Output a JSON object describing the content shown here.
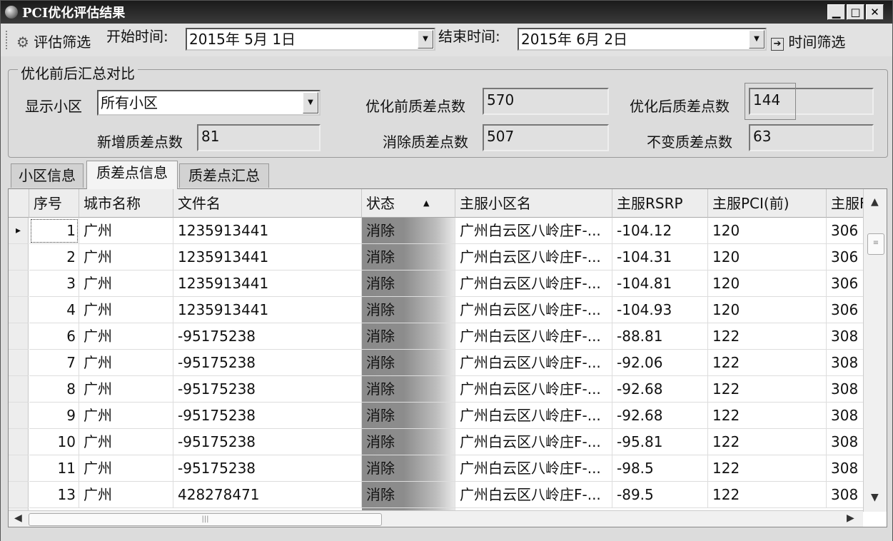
{
  "window": {
    "title": "PCI优化评估结果"
  },
  "toolbar": {
    "filter_label": "评估筛选",
    "start_label": "开始时间:",
    "start_value": "2015年 5月 1日",
    "end_label": "结束时间:",
    "end_value": "2015年 6月 2日",
    "time_filter_label": "时间筛选"
  },
  "summary": {
    "group_title": "优化前后汇总对比",
    "cell_label": "显示小区",
    "cell_value": "所有小区",
    "before_label": "优化前质差点数",
    "before_value": "570",
    "after_label": "优化后质差点数",
    "after_value": "144",
    "new_label": "新增质差点数",
    "new_value": "81",
    "removed_label": "消除质差点数",
    "removed_value": "507",
    "unchanged_label": "不变质差点数",
    "unchanged_value": "63"
  },
  "tabs": [
    "小区信息",
    "质差点信息",
    "质差点汇总"
  ],
  "active_tab": 1,
  "table": {
    "columns": [
      "序号",
      "城市名称",
      "文件名",
      "状态",
      "主服小区名",
      "主服RSRP",
      "主服PCI(前)",
      "主服F"
    ],
    "rows": [
      [
        "1",
        "广州",
        "1235913441",
        "消除",
        "广州白云区八岭庄F-...",
        "-104.12",
        "120",
        "306"
      ],
      [
        "2",
        "广州",
        "1235913441",
        "消除",
        "广州白云区八岭庄F-...",
        "-104.31",
        "120",
        "306"
      ],
      [
        "3",
        "广州",
        "1235913441",
        "消除",
        "广州白云区八岭庄F-...",
        "-104.81",
        "120",
        "306"
      ],
      [
        "4",
        "广州",
        "1235913441",
        "消除",
        "广州白云区八岭庄F-...",
        "-104.93",
        "120",
        "306"
      ],
      [
        "6",
        "广州",
        "-95175238",
        "消除",
        "广州白云区八岭庄F-...",
        "-88.81",
        "122",
        "308"
      ],
      [
        "7",
        "广州",
        "-95175238",
        "消除",
        "广州白云区八岭庄F-...",
        "-92.06",
        "122",
        "308"
      ],
      [
        "8",
        "广州",
        "-95175238",
        "消除",
        "广州白云区八岭庄F-...",
        "-92.68",
        "122",
        "308"
      ],
      [
        "9",
        "广州",
        "-95175238",
        "消除",
        "广州白云区八岭庄F-...",
        "-92.68",
        "122",
        "308"
      ],
      [
        "10",
        "广州",
        "-95175238",
        "消除",
        "广州白云区八岭庄F-...",
        "-95.81",
        "122",
        "308"
      ],
      [
        "11",
        "广州",
        "-95175238",
        "消除",
        "广州白云区八岭庄F-...",
        "-98.5",
        "122",
        "308"
      ],
      [
        "13",
        "广州",
        "428278471",
        "消除",
        "广州白云区八岭庄F-...",
        "-89.5",
        "122",
        "308"
      ]
    ]
  }
}
